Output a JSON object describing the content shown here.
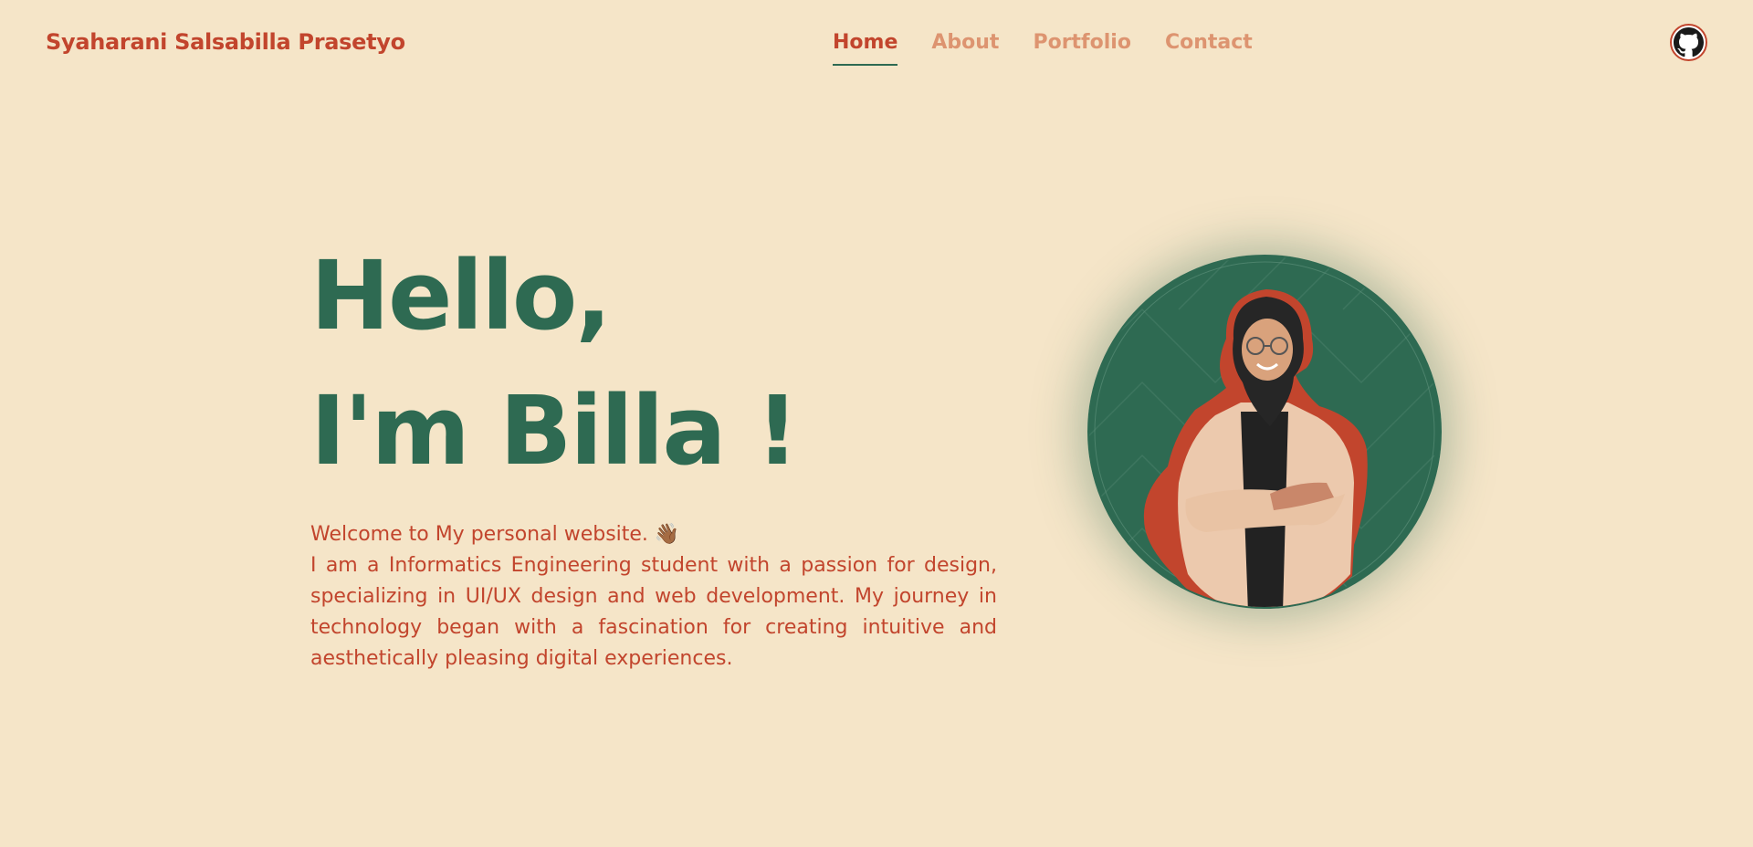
{
  "brand": {
    "name": "Syaharani Salsabilla Prasetyo"
  },
  "nav": {
    "items": [
      {
        "label": "Home",
        "active": true
      },
      {
        "label": "About",
        "active": false
      },
      {
        "label": "Portfolio",
        "active": false
      },
      {
        "label": "Contact",
        "active": false
      }
    ],
    "github_icon": "github-icon"
  },
  "hero": {
    "line1": "Hello,",
    "line2": "I'm Billa !",
    "welcome": "Welcome to My personal website. 👋🏾",
    "description": "I am a Informatics Engineering student with a passion for design, specializing in UI/UX design and web development. My journey in technology began with a fascination for creating intuitive and aesthetically pleasing digital experiences."
  },
  "profile_image": {
    "icon": "profile-photo"
  },
  "colors": {
    "background": "#f5e5c8",
    "primary_green": "#2e6a52",
    "accent_red": "#c2452d",
    "nav_inactive": "#dd9470"
  }
}
